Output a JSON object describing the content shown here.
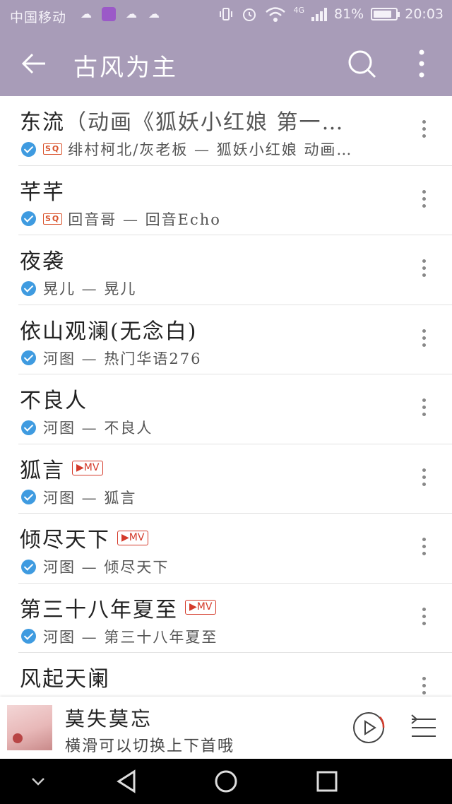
{
  "status_bar": {
    "carrier": "中国移动",
    "network": "4G",
    "battery": "81%",
    "battery_level": 0.81,
    "time": "20:03"
  },
  "app_bar": {
    "title": "古风为主"
  },
  "songs": [
    {
      "title": "东流",
      "title_rest": "（动画《狐妖小红娘 第一…",
      "sq": true,
      "mv": false,
      "subtitle": "绯村柯北/灰老板 — 狐妖小红娘 动画…"
    },
    {
      "title": "芊芊",
      "title_rest": "",
      "sq": true,
      "mv": false,
      "subtitle": "回音哥 — 回音Echo"
    },
    {
      "title": "夜袭",
      "title_rest": "",
      "sq": false,
      "mv": false,
      "subtitle": "晃儿 — 晃儿"
    },
    {
      "title": "依山观澜(无念白)",
      "title_rest": "",
      "sq": false,
      "mv": false,
      "subtitle": "河图 — 热门华语276"
    },
    {
      "title": "不良人",
      "title_rest": "",
      "sq": false,
      "mv": false,
      "subtitle": "河图 — 不良人"
    },
    {
      "title": "狐言",
      "title_rest": "",
      "sq": false,
      "mv": true,
      "subtitle": "河图 — 狐言"
    },
    {
      "title": "倾尽天下",
      "title_rest": "",
      "sq": false,
      "mv": true,
      "subtitle": "河图 — 倾尽天下"
    },
    {
      "title": "第三十八年夏至",
      "title_rest": "",
      "sq": false,
      "mv": true,
      "subtitle": "河图 — 第三十八年夏至"
    },
    {
      "title": "风起天阑",
      "title_rest": "",
      "sq": false,
      "mv": false,
      "subtitle": ""
    }
  ],
  "badges": {
    "sq": "SQ",
    "mv": "MV"
  },
  "player": {
    "song": "莫失莫忘",
    "hint": "横滑可以切换上下首哦"
  },
  "colors": {
    "accent": "#a89cb8",
    "check": "#3f9be0",
    "mv": "#d43a2a"
  }
}
